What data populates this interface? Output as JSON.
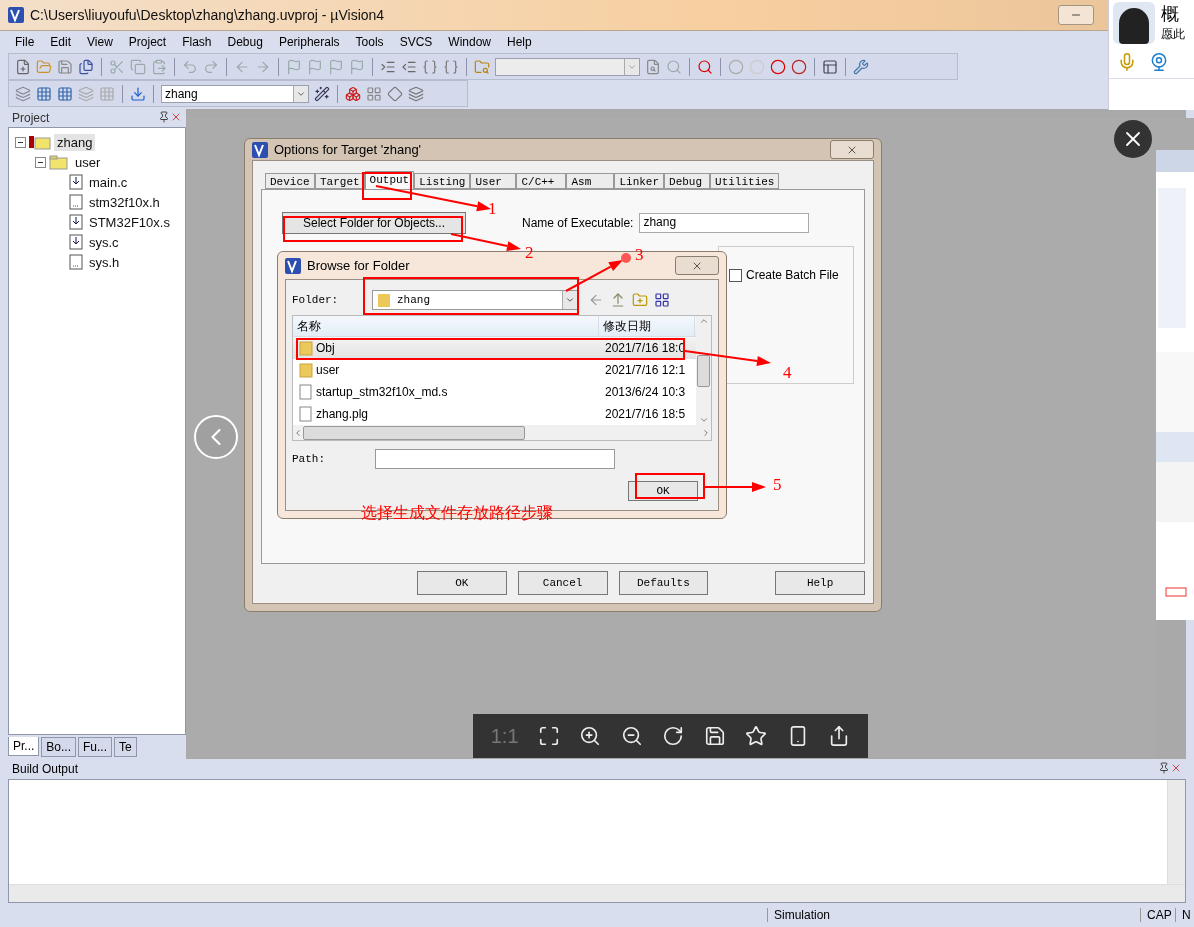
{
  "window": {
    "title": "C:\\Users\\liuyoufu\\Desktop\\zhang\\zhang.uvproj - µVision4"
  },
  "menu": [
    "File",
    "Edit",
    "View",
    "Project",
    "Flash",
    "Debug",
    "Peripherals",
    "Tools",
    "SVCS",
    "Window",
    "Help"
  ],
  "toolbar": {
    "target": "zhang"
  },
  "project_panel": {
    "title": "Project",
    "tree": [
      {
        "label": "zhang",
        "kind": "target",
        "selected": true,
        "expanded": true,
        "children": [
          {
            "label": "user",
            "kind": "folder",
            "selected": false,
            "expanded": true,
            "children": [
              {
                "label": "main.c",
                "kind": "source",
                "selected": false
              },
              {
                "label": "stm32f10x.h",
                "kind": "header",
                "selected": false
              },
              {
                "label": "STM32F10x.s",
                "kind": "source",
                "selected": false
              },
              {
                "label": "sys.c",
                "kind": "source",
                "selected": false
              },
              {
                "label": "sys.h",
                "kind": "header",
                "selected": false
              }
            ]
          }
        ]
      }
    ],
    "tabs": [
      {
        "label": "Pr...",
        "selected": true
      },
      {
        "label": "Bo...",
        "selected": false
      },
      {
        "label": "Fu...",
        "selected": false
      },
      {
        "label": "Te",
        "selected": false
      }
    ]
  },
  "build_output": {
    "title": "Build Output"
  },
  "status_bar": {
    "mode": "Simulation",
    "caps": "CAP",
    "num": "N"
  },
  "chat": {
    "name": "概",
    "status": "愿此"
  },
  "viewer": {
    "ratio": {
      "label": "1:1",
      "disabled": true
    }
  },
  "options_dialog": {
    "title": "Options for Target 'zhang'",
    "tabs": [
      {
        "label": "Device",
        "selected": false
      },
      {
        "label": "Target",
        "selected": false
      },
      {
        "label": "Output",
        "selected": true
      },
      {
        "label": "Listing",
        "selected": false
      },
      {
        "label": "User",
        "selected": false
      },
      {
        "label": "C/C++",
        "selected": false
      },
      {
        "label": "Asm",
        "selected": false
      },
      {
        "label": "Linker",
        "selected": false
      },
      {
        "label": "Debug",
        "selected": false
      },
      {
        "label": "Utilities",
        "selected": false
      }
    ],
    "select_folder_button": "Select Folder for Objects...",
    "executable_label": "Name of Executable:",
    "executable_value": "zhang",
    "batch_file": {
      "label": "Create Batch File",
      "checked": false
    },
    "buttons": [
      "OK",
      "Cancel",
      "Defaults",
      "Help"
    ]
  },
  "browse_dialog": {
    "title": "Browse for Folder",
    "folder_label": "Folder:",
    "folder_value": "zhang",
    "columns": [
      "名称",
      "修改日期"
    ],
    "rows": [
      {
        "name": "Obj",
        "date": "2021/7/16 18:0",
        "kind": "folder",
        "selected": true
      },
      {
        "name": "user",
        "date": "2021/7/16 12:1",
        "kind": "folder",
        "selected": false
      },
      {
        "name": "startup_stm32f10x_md.s",
        "date": "2013/6/24 10:3",
        "kind": "file",
        "selected": false
      },
      {
        "name": "zhang.plg",
        "date": "2021/7/16 18:5",
        "kind": "file",
        "selected": false
      }
    ],
    "path_label": "Path:",
    "ok_button": "OK"
  },
  "annotations": {
    "steps": [
      "1",
      "2",
      "3",
      "4",
      "5"
    ],
    "caption": "选择生成文件存放路径步骤"
  }
}
